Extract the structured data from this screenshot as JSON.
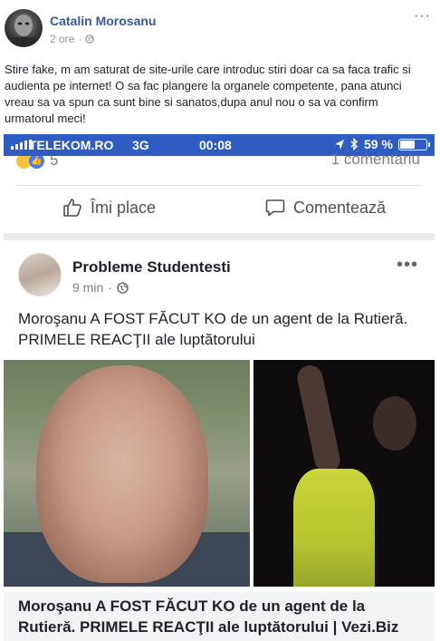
{
  "post": {
    "author": "Catalin Morosanu",
    "time": "2 ore",
    "separator": "·",
    "more": "···",
    "caption": "Stire fake, m am saturat de site-urile care introduc stiri doar ca sa faca trafic si audienta pe internet! O sa fac plangere la organele competente, pana atunci vreau sa va spun ca sunt bine si sanatos,dupa anul nou o sa va confirm urmatorul meci!"
  },
  "status_bar": {
    "carrier": "TELEKOM.RO",
    "network": "3G",
    "time": "00:08",
    "battery_text": "59 %",
    "battery_level": 0.59,
    "accent": "#2f5cc2"
  },
  "shared_card": {
    "reaction_count": "5",
    "comment_count": "1 comentariu",
    "like_label": "Îmi place",
    "comment_label": "Comentează",
    "page_name": "Probleme Studentesti",
    "page_time": "9 min",
    "page_separator": "·",
    "page_more": "•••",
    "headline": "Moroşanu A FOST FĂCUT KO de un agent de la Rutieră. PRIMELE REACŢII ale luptătorului",
    "link_title": "Moroşanu A FOST FĂCUT KO de un agent de la Rutieră. PRIMELE REACŢII ale luptătorului | Vezi.Biz"
  },
  "icons": {
    "globe": "globe-icon",
    "like": "thumbs-up-icon",
    "comment": "comment-bubble-icon",
    "location": "location-arrow-icon",
    "bluetooth": "bluetooth-icon"
  },
  "colors": {
    "author_link": "#385898",
    "status_bar": "#2f5cc2",
    "like_reaction": "#4f7be8",
    "haha_reaction": "#f7c33a"
  }
}
